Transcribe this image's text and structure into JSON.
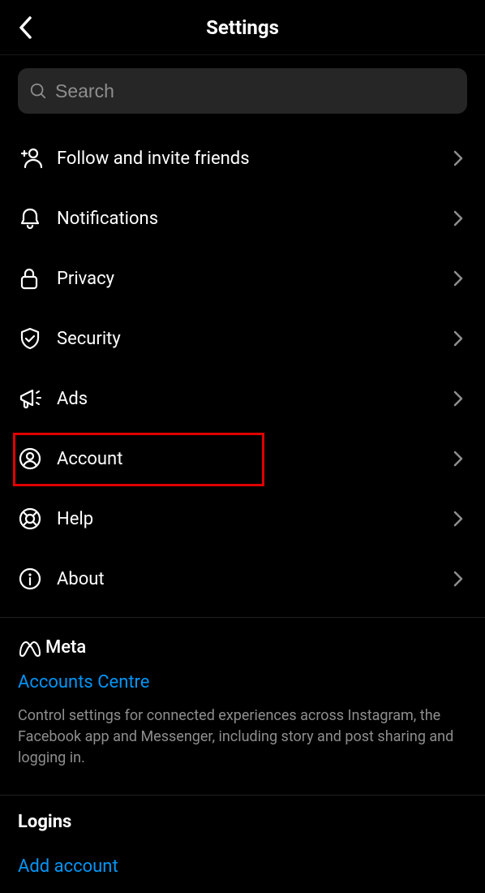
{
  "header": {
    "title": "Settings"
  },
  "search": {
    "placeholder": "Search"
  },
  "menu": {
    "items": [
      {
        "label": "Follow and invite friends",
        "icon": "person-plus-icon",
        "highlight": false
      },
      {
        "label": "Notifications",
        "icon": "bell-icon",
        "highlight": false
      },
      {
        "label": "Privacy",
        "icon": "lock-icon",
        "highlight": false
      },
      {
        "label": "Security",
        "icon": "shield-icon",
        "highlight": false
      },
      {
        "label": "Ads",
        "icon": "megaphone-icon",
        "highlight": false
      },
      {
        "label": "Account",
        "icon": "account-icon",
        "highlight": true
      },
      {
        "label": "Help",
        "icon": "help-icon",
        "highlight": false
      },
      {
        "label": "About",
        "icon": "info-icon",
        "highlight": false
      }
    ]
  },
  "meta": {
    "brand": "Meta",
    "link": "Accounts Centre",
    "description": "Control settings for connected experiences across Instagram, the Facebook app and Messenger, including story and post sharing and logging in."
  },
  "logins": {
    "title": "Logins",
    "add_account": "Add account"
  },
  "colors": {
    "accent": "#0095f6",
    "highlight_border": "#e00000"
  }
}
